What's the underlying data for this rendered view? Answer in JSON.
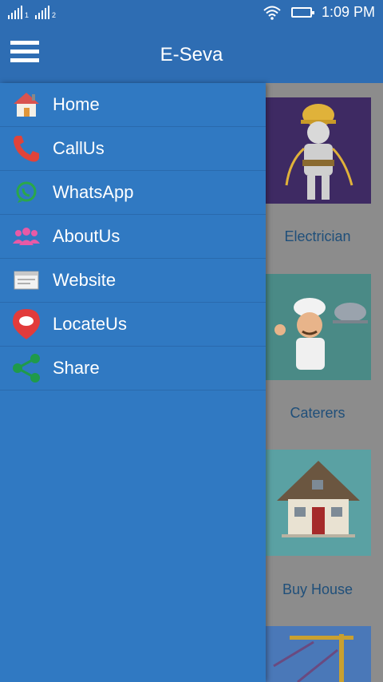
{
  "statusbar": {
    "sim1_label": "1",
    "sim2_label": "2",
    "time": "1:09 PM"
  },
  "appbar": {
    "title": "E-Seva",
    "menu_icon": "hamburger-menu-icon"
  },
  "drawer": {
    "items": [
      {
        "label": "Home",
        "icon": "home-icon"
      },
      {
        "label": "CallUs",
        "icon": "phone-icon"
      },
      {
        "label": "WhatsApp",
        "icon": "whatsapp-icon"
      },
      {
        "label": "AboutUs",
        "icon": "group-icon"
      },
      {
        "label": "Website",
        "icon": "browser-window-icon"
      },
      {
        "label": "LocateUs",
        "icon": "location-pin-icon"
      },
      {
        "label": "Share",
        "icon": "share-icon"
      }
    ]
  },
  "services": [
    {
      "label": "Electrician",
      "image": "electrician-figure"
    },
    {
      "label": "Caterers",
      "image": "chef-figure"
    },
    {
      "label": "Buy House",
      "image": "house"
    }
  ],
  "colors": {
    "primary": "#2E6DB3",
    "drawer": "#3079C2",
    "service_label": "#1f4f7a"
  }
}
